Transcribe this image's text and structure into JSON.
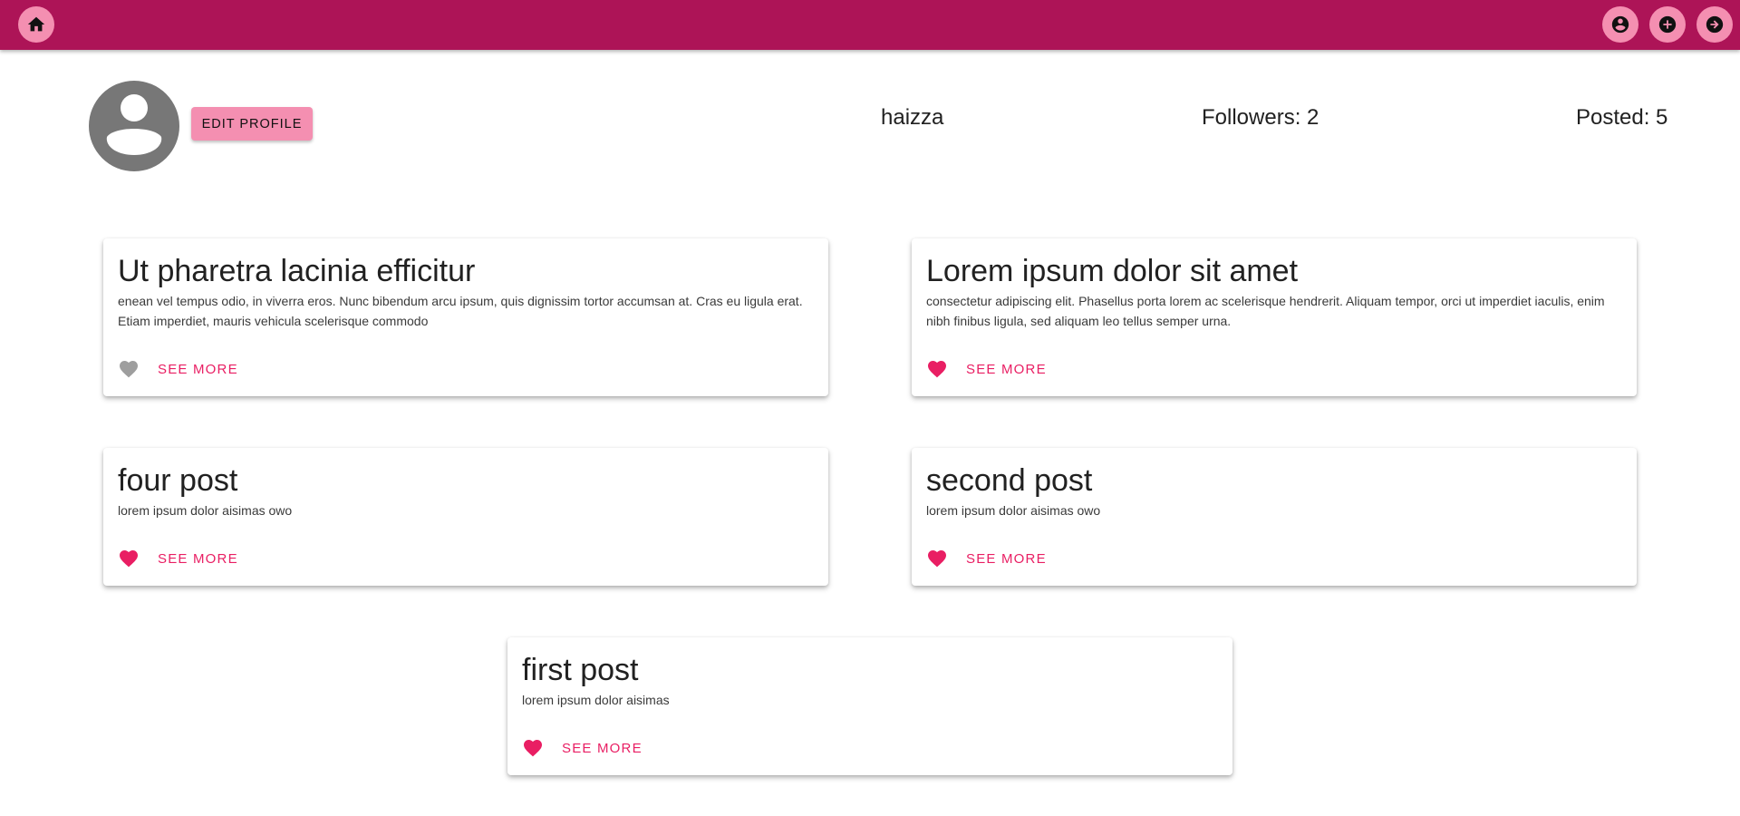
{
  "nav": {
    "home_icon": "home-icon",
    "account_icon": "account-circle-icon",
    "add_icon": "add-circle-icon",
    "logout_icon": "arrow-circle-right-icon"
  },
  "profile": {
    "edit_label": "EDIT PROFILE",
    "username": "haizza",
    "followers": "Followers: 2",
    "posted": "Posted: 5"
  },
  "posts": [
    {
      "title": "Ut pharetra lacinia efficitur",
      "body": "enean vel tempus odio, in viverra eros. Nunc bibendum arcu ipsum, quis dignissim tortor accumsan at. Cras eu ligula erat. Etiam imperdiet, mauris vehicula scelerisque commodo",
      "liked": false,
      "action": "SEE MORE"
    },
    {
      "title": "Lorem ipsum dolor sit amet",
      "body": "consectetur adipiscing elit. Phasellus porta lorem ac scelerisque hendrerit. Aliquam tempor, orci ut imperdiet iaculis, enim nibh finibus ligula, sed aliquam leo tellus semper urna.",
      "liked": true,
      "action": "SEE MORE"
    },
    {
      "title": "four post",
      "body": "lorem ipsum dolor aisimas owo",
      "liked": true,
      "action": "SEE MORE"
    },
    {
      "title": "second post",
      "body": "lorem ipsum dolor aisimas owo",
      "liked": true,
      "action": "SEE MORE"
    },
    {
      "title": "first post",
      "body": "lorem ipsum dolor aisimas",
      "liked": true,
      "action": "SEE MORE"
    }
  ],
  "colors": {
    "appbar": "#ad1457",
    "accent_light": "#f48fb1",
    "liked": "#e91e63",
    "unliked": "#9e9e9e"
  }
}
